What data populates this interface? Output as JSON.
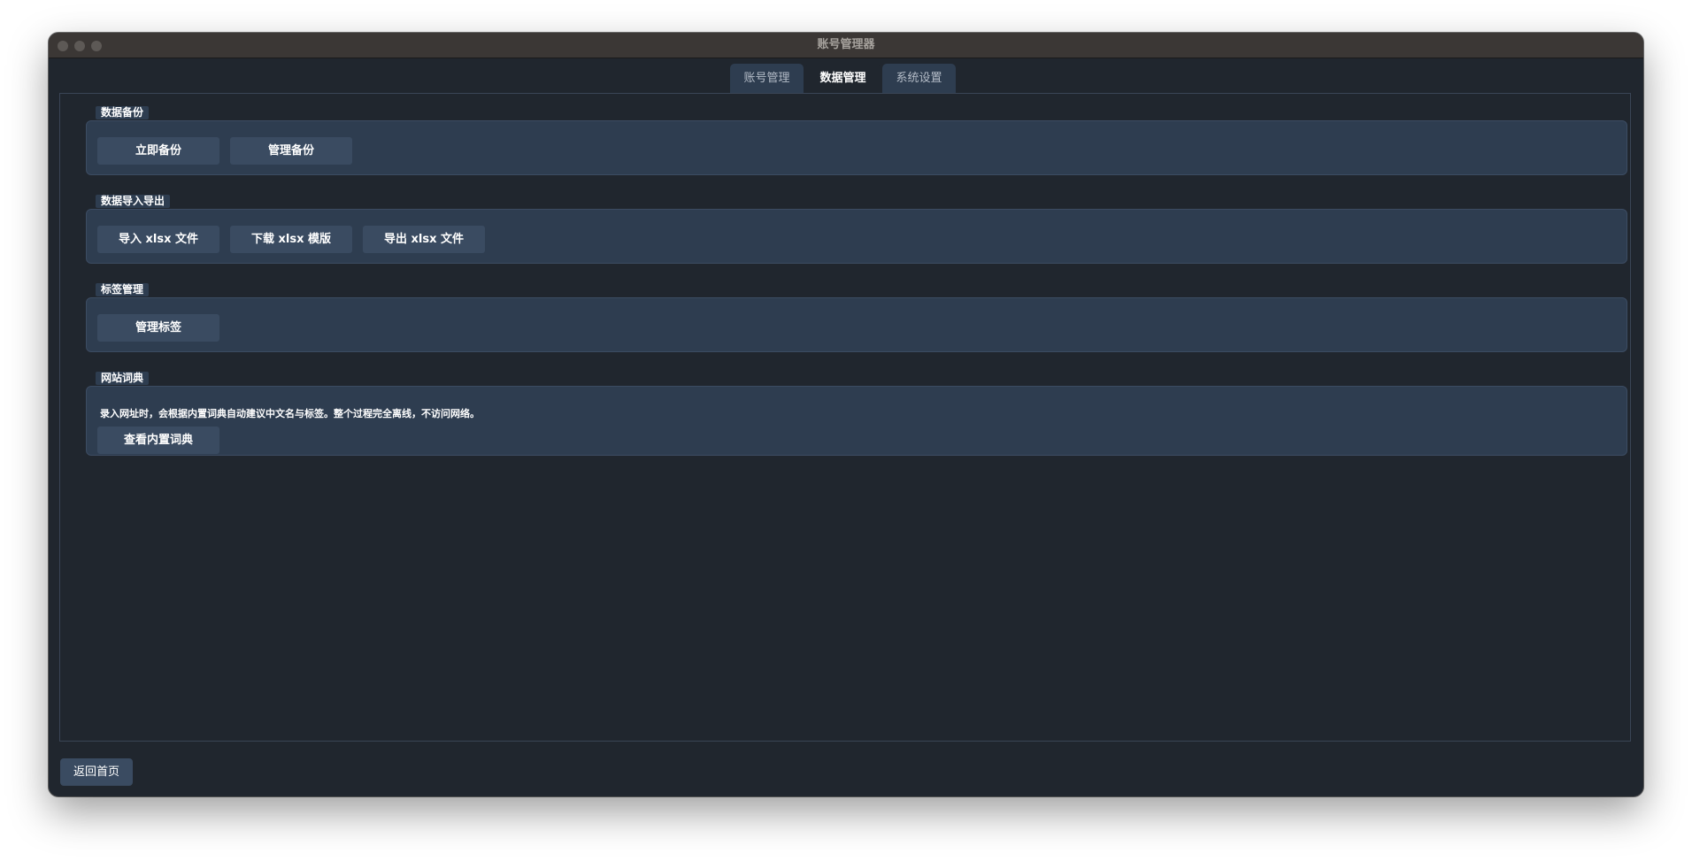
{
  "window": {
    "title": "账号管理器"
  },
  "tabs": [
    {
      "label": "账号管理",
      "active": false
    },
    {
      "label": "数据管理",
      "active": true
    },
    {
      "label": "系统设置",
      "active": false
    }
  ],
  "groups": {
    "backup": {
      "title": "数据备份",
      "buttons": [
        "立即备份",
        "管理备份"
      ]
    },
    "import_export": {
      "title": "数据导入导出",
      "buttons": [
        "导入 xlsx 文件",
        "下载 xlsx 模版",
        "导出 xlsx 文件"
      ]
    },
    "tags": {
      "title": "标签管理",
      "buttons": [
        "管理标签"
      ]
    },
    "dictionary": {
      "title": "网站词典",
      "description": "录入网址时，会根据内置词典自动建议中文名与标签。整个过程完全离线，不访问网络。",
      "buttons": [
        "查看内置词典"
      ]
    }
  },
  "footer": {
    "back_label": "返回首页"
  },
  "colors": {
    "window_bg": "#20262e",
    "panel_bg": "#2e3d50",
    "button_bg": "#3a4b61",
    "titlebar_bg": "#3b3735"
  },
  "icons": [
    "close-traffic-light-icon",
    "minimize-traffic-light-icon",
    "zoom-traffic-light-icon"
  ]
}
